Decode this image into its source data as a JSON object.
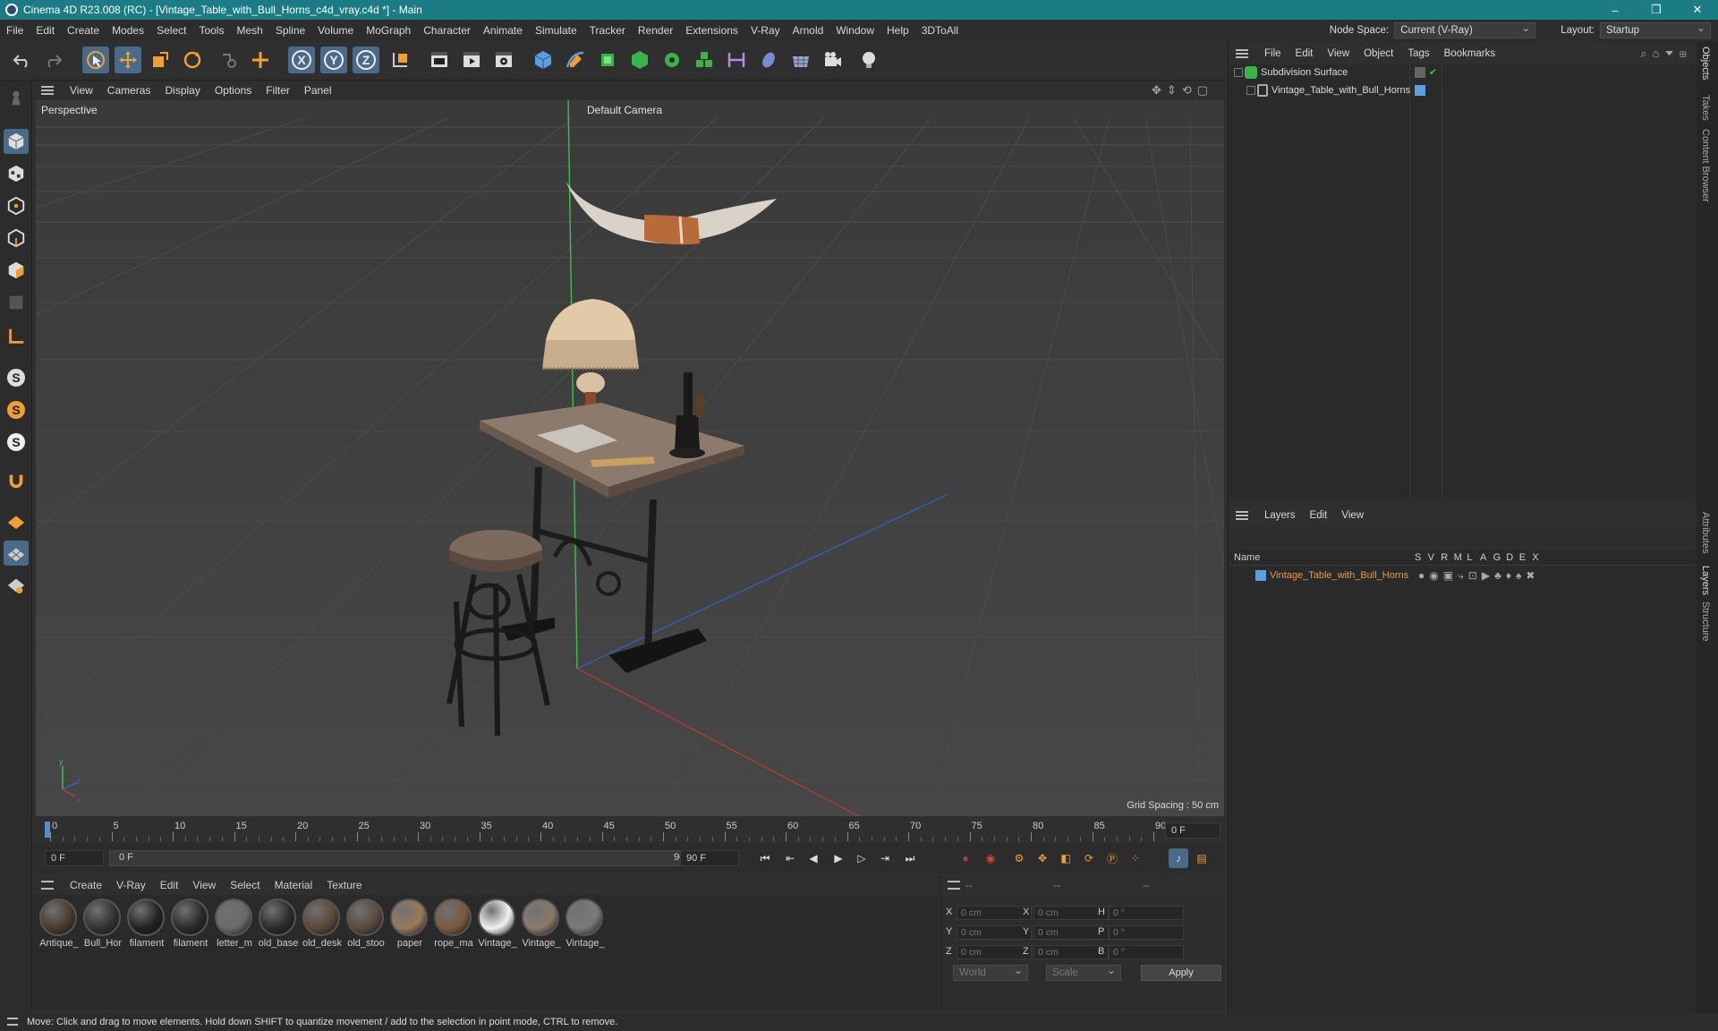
{
  "window": {
    "title": "Cinema 4D R23.008 (RC) - [Vintage_Table_with_Bull_Horns_c4d_vray.c4d *] - Main",
    "controls": [
      "–",
      "❐",
      "✕"
    ]
  },
  "menubar": {
    "items": [
      "File",
      "Edit",
      "Create",
      "Modes",
      "Select",
      "Tools",
      "Mesh",
      "Spline",
      "Volume",
      "MoGraph",
      "Character",
      "Animate",
      "Simulate",
      "Tracker",
      "Render",
      "Extensions",
      "V-Ray",
      "Arnold",
      "Window",
      "Help",
      "3DToAll"
    ],
    "node_space_label": "Node Space:",
    "node_space_value": "Current (V-Ray)",
    "layout_label": "Layout:",
    "layout_value": "Startup"
  },
  "viewport": {
    "menu": [
      "View",
      "Cameras",
      "Display",
      "Options",
      "Filter",
      "Panel"
    ],
    "label": "Perspective",
    "camera": "Default Camera",
    "grid_spacing": "Grid Spacing : 50 cm"
  },
  "timeline": {
    "ticks": [
      "0",
      "5",
      "10",
      "15",
      "20",
      "25",
      "30",
      "35",
      "40",
      "45",
      "50",
      "55",
      "60",
      "65",
      "70",
      "75",
      "80",
      "85",
      "90"
    ],
    "current_frame_field": "0 F",
    "start_field": "0 F",
    "range_start": "0 F",
    "range_end": "90 F",
    "end_field": "90 F"
  },
  "materials": {
    "menu": [
      "Create",
      "V-Ray",
      "Edit",
      "View",
      "Select",
      "Material",
      "Texture"
    ],
    "items": [
      {
        "label": "Antique_",
        "color": "#4a3a2a"
      },
      {
        "label": "Bull_Hor",
        "color": "#333333"
      },
      {
        "label": "filament",
        "color": "#222222"
      },
      {
        "label": "filament",
        "color": "#2a2a2a"
      },
      {
        "label": "letter_m",
        "color": "#6a6a6a"
      },
      {
        "label": "old_base",
        "color": "#2b2b2b"
      },
      {
        "label": "old_desk",
        "color": "#5a4838"
      },
      {
        "label": "old_stoo",
        "color": "#5a4a3e"
      },
      {
        "label": "paper",
        "color": "#9a7a58"
      },
      {
        "label": "rope_ma",
        "color": "#7a5a40"
      },
      {
        "label": "Vintage_",
        "color": "#f2f2f2"
      },
      {
        "label": "Vintage_",
        "color": "#8a7a6a"
      },
      {
        "label": "Vintage_",
        "color": "#7a7a7a"
      }
    ]
  },
  "coords": {
    "header": [
      "--",
      "--",
      "--"
    ],
    "rows": [
      {
        "l1": "X",
        "v1": "0 cm",
        "l2": "X",
        "v2": "0 cm",
        "l3": "H",
        "v3": "0 °"
      },
      {
        "l1": "Y",
        "v1": "0 cm",
        "l2": "Y",
        "v2": "0 cm",
        "l3": "P",
        "v3": "0 °"
      },
      {
        "l1": "Z",
        "v1": "0 cm",
        "l2": "Z",
        "v2": "0 cm",
        "l3": "B",
        "v3": "0 °"
      }
    ],
    "world": "World",
    "scale": "Scale",
    "apply": "Apply"
  },
  "objects": {
    "menu": [
      "File",
      "Edit",
      "View",
      "Object",
      "Tags",
      "Bookmarks"
    ],
    "rows": [
      {
        "name": "Subdivision Surface"
      },
      {
        "name": "Vintage_Table_with_Bull_Horns"
      }
    ]
  },
  "layers": {
    "menu": [
      "Layers",
      "Edit",
      "View"
    ],
    "columns": [
      "Name",
      "S",
      "V",
      "R",
      "M",
      "L",
      "A",
      "G",
      "D",
      "E",
      "X"
    ],
    "rows": [
      {
        "name": "Vintage_Table_with_Bull_Horns"
      }
    ]
  },
  "side_tabs": [
    "Objects",
    "Takes",
    "Content Browser",
    "Attributes",
    "Layers",
    "Structure"
  ],
  "status": "Move: Click and drag to move elements. Hold down SHIFT to quantize movement / add to the selection in point mode, CTRL to remove.",
  "colors": {
    "accent": "#4a6a8a",
    "title_bar": "#1c7c86",
    "layer_name": "#e89a3c",
    "axis_green": "#3cc14a",
    "axis_blue": "#2f63c8",
    "axis_red": "#c0392b"
  }
}
